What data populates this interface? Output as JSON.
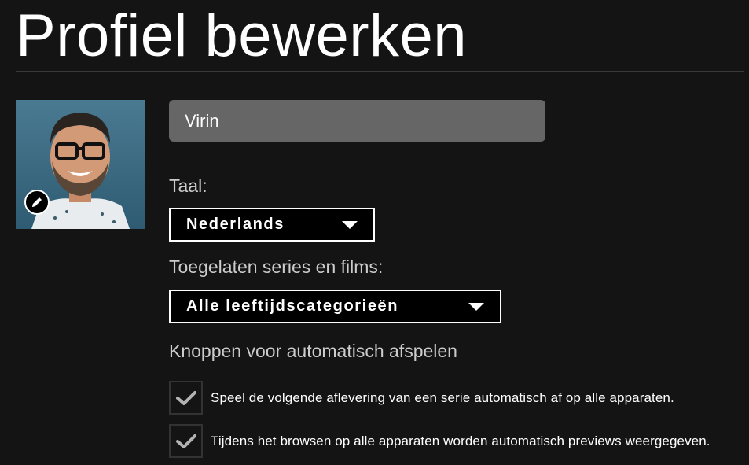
{
  "header": {
    "title": "Profiel bewerken"
  },
  "profile": {
    "avatar_icon": "profile-avatar-photo",
    "edit_icon": "pencil-icon",
    "name_value": "Virin"
  },
  "language": {
    "label": "Taal:",
    "selected": "Nederlands"
  },
  "maturity": {
    "label": "Toegelaten series en films:",
    "selected": "Alle leeftijdscategorieën"
  },
  "autoplay": {
    "label": "Knoppen voor automatisch afspelen",
    "options": [
      {
        "label": "Speel de volgende aflevering van een serie automatisch af op alle apparaten.",
        "checked": true
      },
      {
        "label": "Tijdens het browsen op alle apparaten worden automatisch previews weergegeven.",
        "checked": true
      }
    ]
  },
  "colors": {
    "background": "#141414",
    "input_bg": "#666666",
    "label_text": "#cccccc",
    "check_mark": "#b3b3b3"
  }
}
